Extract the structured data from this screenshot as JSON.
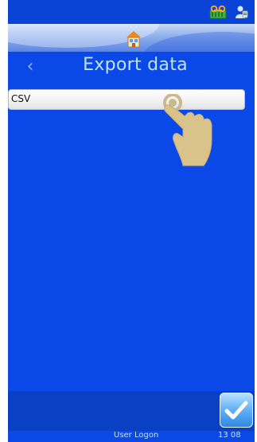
{
  "header": {
    "title": "Export data",
    "icons": [
      "tape-cassette-icon",
      "person-icon",
      "home-icon",
      "chevron-left-icon"
    ]
  },
  "list": {
    "items": [
      {
        "label": "CSV"
      }
    ]
  },
  "footer": {
    "status_text": "User Logon",
    "time": "13 08",
    "confirm_icon": "checkmark-icon"
  },
  "colors": {
    "background": "#0a49e8",
    "title_text": "#bfe3ff",
    "confirm_button": "#5fb0f5"
  }
}
